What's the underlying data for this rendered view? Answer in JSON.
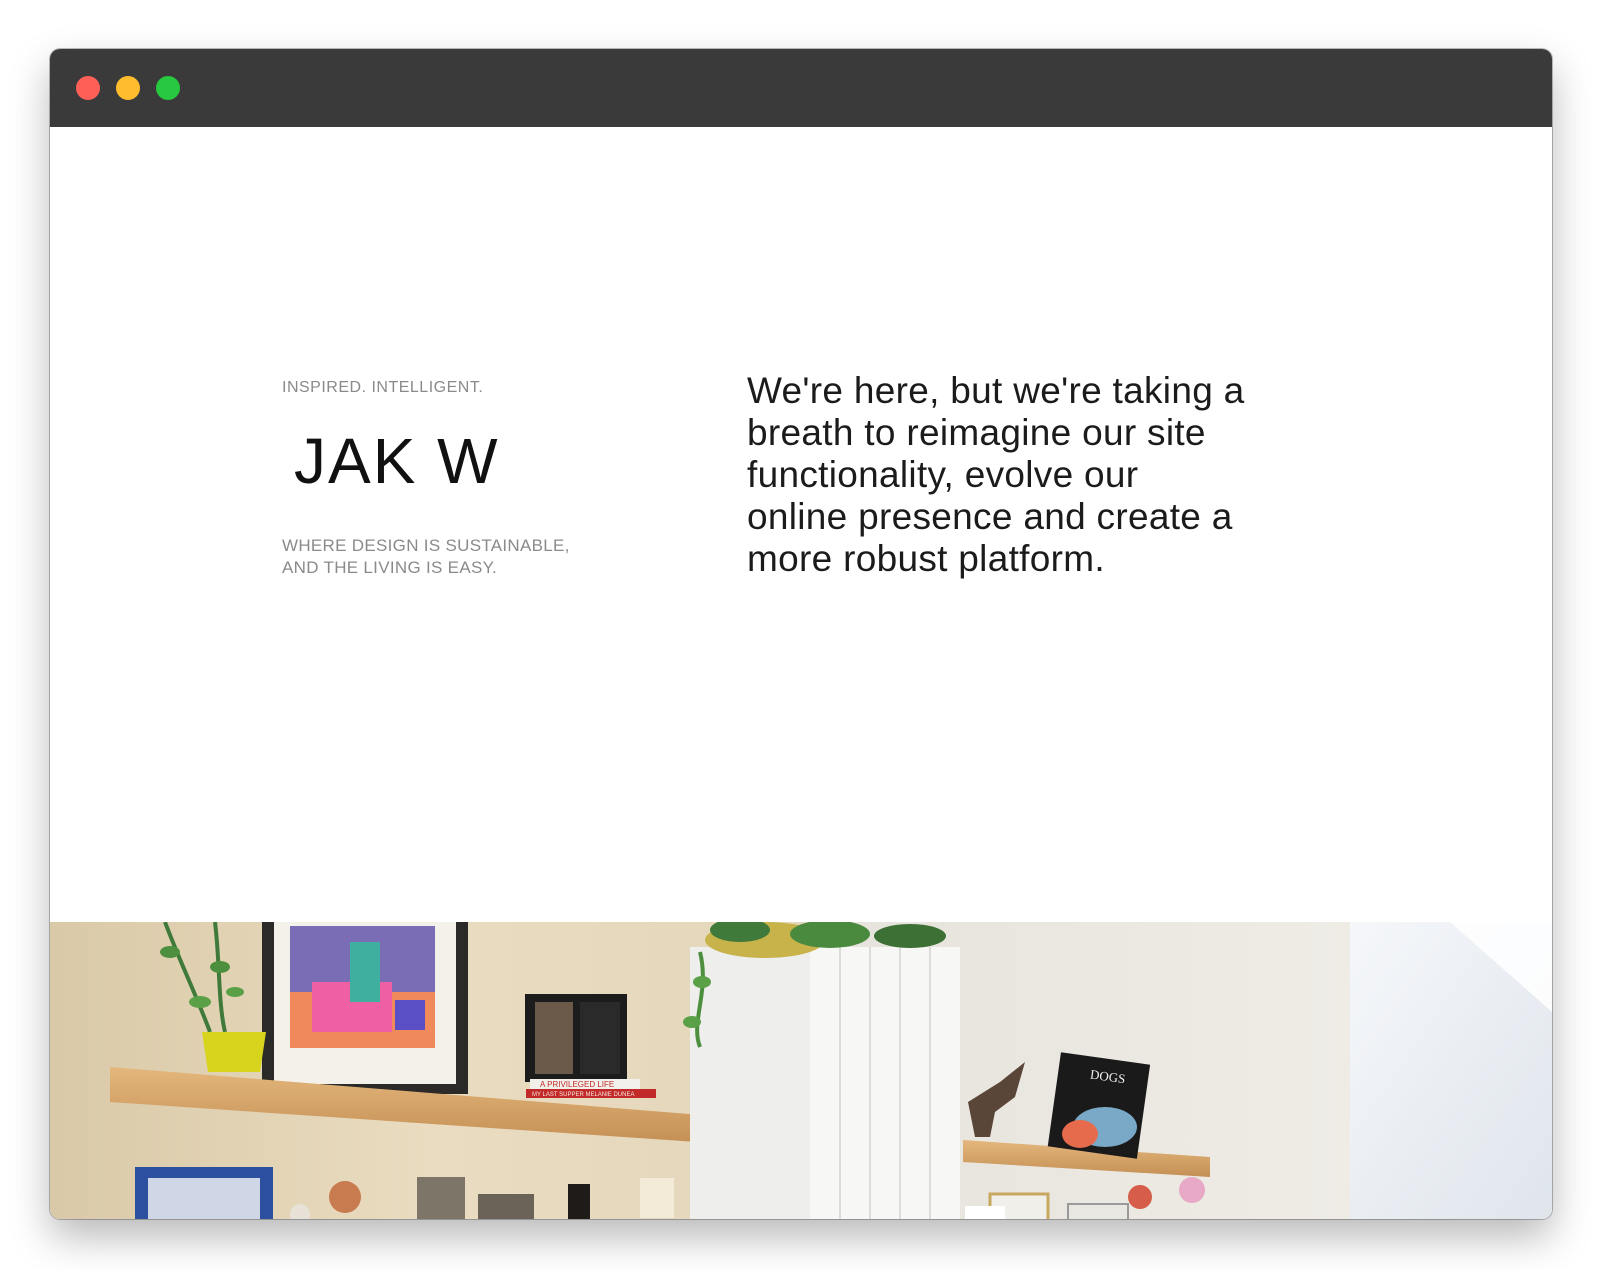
{
  "window": {
    "controls": {
      "close_color": "#ff5f57",
      "minimize_color": "#febc2e",
      "zoom_color": "#28c840"
    }
  },
  "hero": {
    "tagline": "INSPIRED. INTELLIGENT.",
    "brand": "JAK W",
    "subline": [
      "WHERE DESIGN IS SUSTAINABLE,",
      "AND THE LIVING IS EASY."
    ],
    "message_lines": [
      "We're here, but we're taking a",
      "breath to reimagine our site",
      "functionality, evolve our",
      "online presence and create a",
      "more robust platform."
    ]
  },
  "photo": {
    "book_spine_1": "A PRIVILEGED LIFE",
    "book_spine_2": "MY LAST SUPPER  MELANIE DUNEA",
    "book_cover": "DOGS"
  }
}
